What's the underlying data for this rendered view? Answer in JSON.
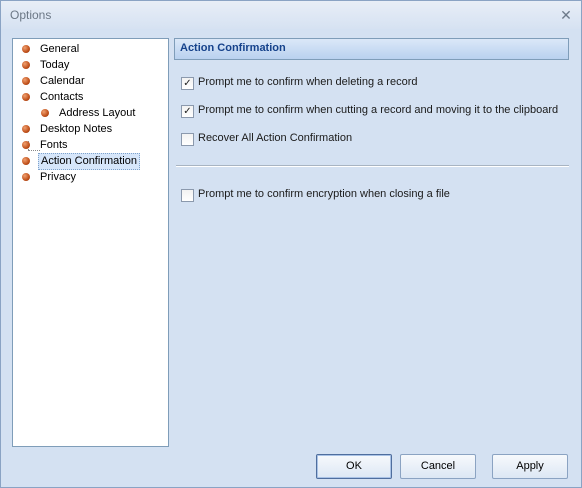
{
  "window": {
    "title": "Options",
    "close_glyph": "✕"
  },
  "tree": {
    "items": [
      {
        "label": "General",
        "selected": false,
        "indent": 0
      },
      {
        "label": "Today",
        "selected": false,
        "indent": 0
      },
      {
        "label": "Calendar",
        "selected": false,
        "indent": 0
      },
      {
        "label": "Contacts",
        "selected": false,
        "indent": 0
      },
      {
        "label": "Address Layout",
        "selected": false,
        "indent": 1
      },
      {
        "label": "Desktop Notes",
        "selected": false,
        "indent": 0
      },
      {
        "label": "Fonts",
        "selected": false,
        "indent": 0
      },
      {
        "label": "Action Confirmation",
        "selected": true,
        "indent": 0
      },
      {
        "label": "Privacy",
        "selected": false,
        "indent": 0
      }
    ]
  },
  "panel": {
    "title": "Action Confirmation",
    "options": [
      {
        "label": "Prompt me to confirm when deleting a record",
        "checked": true
      },
      {
        "label": "Prompt me to confirm when cutting a record and moving it to the clipboard",
        "checked": true
      },
      {
        "label": "Recover All Action Confirmation",
        "checked": false
      },
      {
        "label": "Prompt me to confirm encryption when closing a file",
        "checked": false
      }
    ]
  },
  "buttons": {
    "ok": "OK",
    "cancel": "Cancel",
    "apply": "Apply"
  },
  "colors": {
    "accent": "#15428b",
    "window_bg": "#d4e1f2",
    "bullet": "#c0501a"
  },
  "icons": {
    "close": "close-icon",
    "bullet": "bullet-icon",
    "checkmark": "checkmark-icon"
  }
}
